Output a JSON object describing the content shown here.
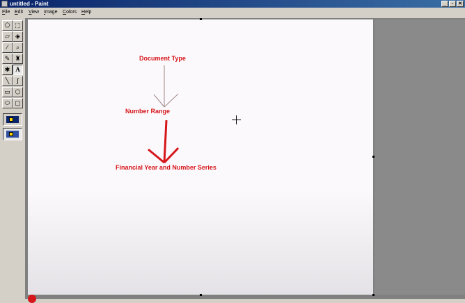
{
  "window": {
    "title": "untitled - Paint"
  },
  "window_controls": {
    "minimize": "_",
    "maximize": "▫",
    "close": "✕"
  },
  "menu": [
    {
      "label": "File"
    },
    {
      "label": "Edit"
    },
    {
      "label": "View"
    },
    {
      "label": "Image"
    },
    {
      "label": "Colors"
    },
    {
      "label": "Help"
    }
  ],
  "tools": [
    {
      "name": "free-form-select-tool",
      "glyph": "⬠"
    },
    {
      "name": "rect-select-tool",
      "glyph": "⬚"
    },
    {
      "name": "eraser-tool",
      "glyph": "▱"
    },
    {
      "name": "fill-tool",
      "glyph": "◈"
    },
    {
      "name": "color-picker-tool",
      "glyph": "⁄"
    },
    {
      "name": "magnifier-tool",
      "glyph": "⌕"
    },
    {
      "name": "pencil-tool",
      "glyph": "✎"
    },
    {
      "name": "brush-tool",
      "glyph": "♜"
    },
    {
      "name": "airbrush-tool",
      "glyph": "✱"
    },
    {
      "name": "text-tool",
      "glyph": "A"
    },
    {
      "name": "line-tool",
      "glyph": "╲"
    },
    {
      "name": "curve-tool",
      "glyph": "∫"
    },
    {
      "name": "rectangle-tool",
      "glyph": "▭"
    },
    {
      "name": "polygon-tool",
      "glyph": "⬡"
    },
    {
      "name": "ellipse-tool",
      "glyph": "⬭"
    },
    {
      "name": "rounded-rect-tool",
      "glyph": "▢"
    }
  ],
  "canvas": {
    "labels": {
      "document_type": "Document Type",
      "number_range": "Number Range",
      "financial_year": "Financial Year and Number Series"
    },
    "colors": {
      "ink": "#d5161a",
      "thin_arrow": "#a08888"
    }
  }
}
